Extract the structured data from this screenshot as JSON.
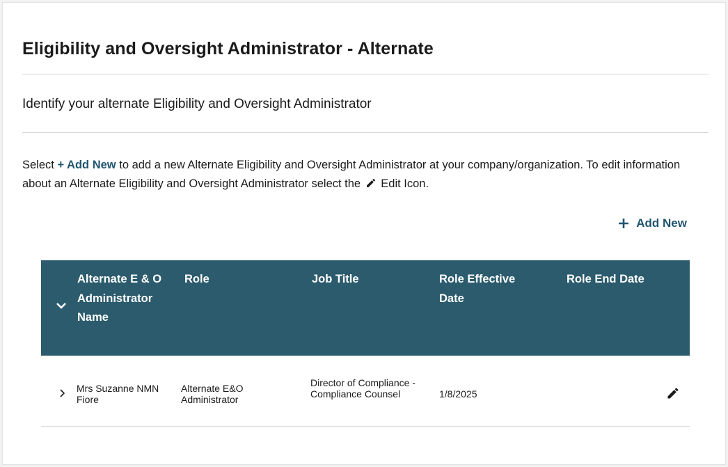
{
  "page": {
    "title": "Eligibility and Oversight Administrator - Alternate",
    "subtitle": "Identify your alternate Eligibility and Oversight Administrator",
    "instructions": {
      "part1": "Select ",
      "add_link": "+ Add New",
      "part2": " to add a new Alternate Eligibility and Oversight Administrator at your company/organization. To edit information about an Alternate Eligibility and Oversight Administrator select the ",
      "edit_icon": "pencil-icon",
      "part3": " Edit Icon."
    },
    "add_new_label": "Add New"
  },
  "table": {
    "headers": [
      "Alternate E & O Administrator Name",
      "Role",
      "Job Title",
      "Role Effective Date",
      "Role End Date"
    ],
    "rows": [
      {
        "name": "Mrs Suzanne NMN Fiore",
        "role": "Alternate E&O Administrator",
        "job_title": "Director of Compliance - Compliance Counsel",
        "effective_date": "1/8/2025",
        "end_date": ""
      }
    ]
  },
  "colors": {
    "header_bg": "#2b5b6d",
    "link": "#1f5570",
    "text": "#1b1b1b"
  },
  "icons": {
    "header_expand": "chevron-down-icon",
    "row_expand": "chevron-right-icon",
    "row_edit": "pencil-icon",
    "add": "plus-icon"
  }
}
